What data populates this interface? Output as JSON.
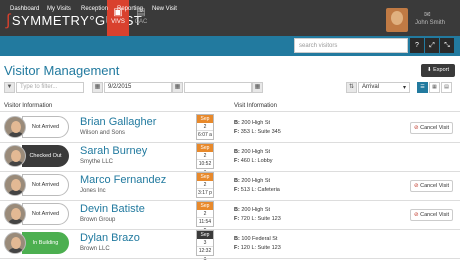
{
  "app": {
    "logo_text": "SYMMETRY",
    "logo_suffix": "GUEST",
    "tab_vivs": "VIVS",
    "tab_cac": "CAC",
    "user_name": "John Smith"
  },
  "nav": {
    "items": [
      "Dashboard",
      "My Visits",
      "Reception",
      "Reporting",
      "New Visit"
    ],
    "search_placeholder": "search visitors",
    "buttons": [
      "?",
      "⤢",
      "⤡",
      "⚙"
    ]
  },
  "page": {
    "title": "Visitor Management",
    "export_label": "Export"
  },
  "filters": {
    "type_placeholder": "Type to filter...",
    "date_from": "9/2/2015",
    "date_to": "",
    "sort_value": "Arrival"
  },
  "table": {
    "col_visitor": "Visitor Information",
    "col_visit": "Visit Information",
    "cancel_label": "Cancel Visit",
    "rows": [
      {
        "name": "Brian Gallagher",
        "company": "Wilson and Sons",
        "status": "Not Arrived",
        "mon": "Sep",
        "day": "2",
        "time": "6:07 a",
        "b": "200 High St",
        "f": "353 L: Suite 345",
        "cancel": true
      },
      {
        "name": "Sarah Burney",
        "company": "Smythe LLC",
        "status": "Checked Out",
        "mon": "Sep",
        "day": "2",
        "time": "10:52 a",
        "b": "200 High St",
        "f": "460 L: Lobby",
        "cancel": false
      },
      {
        "name": "Marco Fernandez",
        "company": "Jones Inc",
        "status": "Not Arrived",
        "mon": "Sep",
        "day": "2",
        "time": "3:17 p",
        "b": "200 High St",
        "f": "513 L: Cafeteria",
        "cancel": true
      },
      {
        "name": "Devin Batiste",
        "company": "Brown Group",
        "status": "Not Arrived",
        "mon": "Sep",
        "day": "2",
        "time": "11:54 p",
        "b": "200 High St",
        "f": "720 L: Suite 123",
        "cancel": true
      },
      {
        "name": "Dylan Brazo",
        "company": "Brown LLC",
        "status": "In Building",
        "mon": "Sep",
        "day": "3",
        "time": "12:32 a",
        "b": "100 Federal St",
        "f": "120 L: Suite 123",
        "cancel": false
      }
    ]
  }
}
